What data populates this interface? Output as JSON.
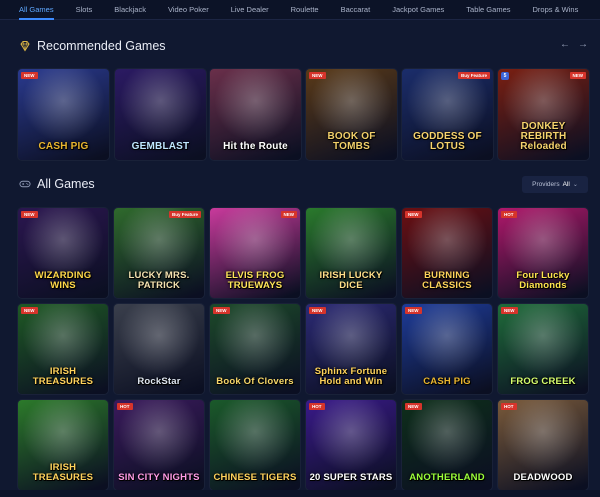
{
  "nav": {
    "tabs": [
      {
        "label": "All Games",
        "active": true
      },
      {
        "label": "Slots"
      },
      {
        "label": "Blackjack"
      },
      {
        "label": "Video Poker"
      },
      {
        "label": "Live Dealer"
      },
      {
        "label": "Roulette"
      },
      {
        "label": "Baccarat"
      },
      {
        "label": "Jackpot Games"
      },
      {
        "label": "Table Games"
      },
      {
        "label": "Drops & Wins"
      }
    ]
  },
  "recommended": {
    "title": "Recommended Games",
    "prev_arrow": "←",
    "next_arrow": "→",
    "games": [
      {
        "name": "CASH PIG",
        "badge": "NEW",
        "color": "#e8b530",
        "bg": "#2a3a8f"
      },
      {
        "name": "GEMBLAST",
        "badge": "",
        "color": "#bfe7ff",
        "bg": "#2b1a63"
      },
      {
        "name": "Hit the Route",
        "badge": "",
        "color": "#ffffff",
        "bg": "#6a2f4a"
      },
      {
        "name": "BOOK OF TOMBS",
        "badge": "NEW",
        "color": "#f2d06a",
        "bg": "#5a3a18"
      },
      {
        "name": "GODDESS OF LOTUS",
        "badge": "",
        "badge_right": "Buy Feature",
        "color": "#f7d46e",
        "bg": "#1b2d6b"
      },
      {
        "name": "DONKEY REBIRTH Reloaded",
        "badge5": "5",
        "badge_right": "NEW",
        "color": "#f7d46e",
        "bg": "#7a1f12"
      }
    ]
  },
  "all_games": {
    "title": "All Games",
    "providers_label": "Providers",
    "providers_value": "All",
    "chevron": "⌄",
    "games": [
      {
        "name": "WIZARDING WINS",
        "badge": "NEW",
        "color": "#ffd84a",
        "bg": "#2b1650"
      },
      {
        "name": "LUCKY MRS. PATRICK",
        "badge_right": "Buy Feature",
        "color": "#f3e2b0",
        "bg": "#2f6a2c"
      },
      {
        "name": "ELVIS FROG TRUEWAYS",
        "badge_right": "NEW",
        "color": "#ffe45a",
        "bg": "#c93a9c"
      },
      {
        "name": "IRISH LUCKY DICE",
        "badge": "",
        "color": "#ffe08a",
        "bg": "#2a7a2c"
      },
      {
        "name": "BURNING CLASSICS",
        "badge": "NEW",
        "color": "#ffd35c",
        "bg": "#6b0f12"
      },
      {
        "name": "Four Lucky Diamonds",
        "badge": "HOT",
        "color": "#ffe44f",
        "bg": "#b0186b"
      },
      {
        "name": "IRISH TREASURES",
        "badge": "NEW",
        "color": "#ffd35c",
        "bg": "#1f5a25"
      },
      {
        "name": "RockStar",
        "badge": "",
        "color": "#dfe6f0",
        "bg": "#3a3f4c"
      },
      {
        "name": "Book Of Clovers",
        "badge": "NEW",
        "color": "#f6d76a",
        "bg": "#1d4a2a"
      },
      {
        "name": "Sphinx Fortune Hold and Win",
        "badge": "NEW",
        "color": "#ffd35c",
        "bg": "#2c2a75"
      },
      {
        "name": "CASH PIG",
        "badge": "NEW",
        "color": "#e8b530",
        "bg": "#1e3c9a"
      },
      {
        "name": "FROG CREEK",
        "badge": "NEW",
        "color": "#d7ff6e",
        "bg": "#1f6c3a"
      },
      {
        "name": "IRISH TREASURES",
        "badge": "",
        "color": "#ffd35c",
        "bg": "#2c7a2a"
      },
      {
        "name": "SIN CITY NIGHTS",
        "badge": "HOT",
        "color": "#ff9be6",
        "bg": "#3a1a5c"
      },
      {
        "name": "CHINESE TIGERS",
        "badge": "",
        "color": "#ffd35c",
        "bg": "#1b5a2a"
      },
      {
        "name": "20 SUPER STARS",
        "badge": "HOT",
        "color": "#ffffff",
        "bg": "#3a1a8a"
      },
      {
        "name": "ANOTHERLAND",
        "badge": "NEW",
        "color": "#9bff3a",
        "bg": "#0e2f1a"
      },
      {
        "name": "DEADWOOD",
        "badge": "HOT",
        "color": "#ffffff",
        "bg": "#7a5a3a"
      }
    ]
  }
}
